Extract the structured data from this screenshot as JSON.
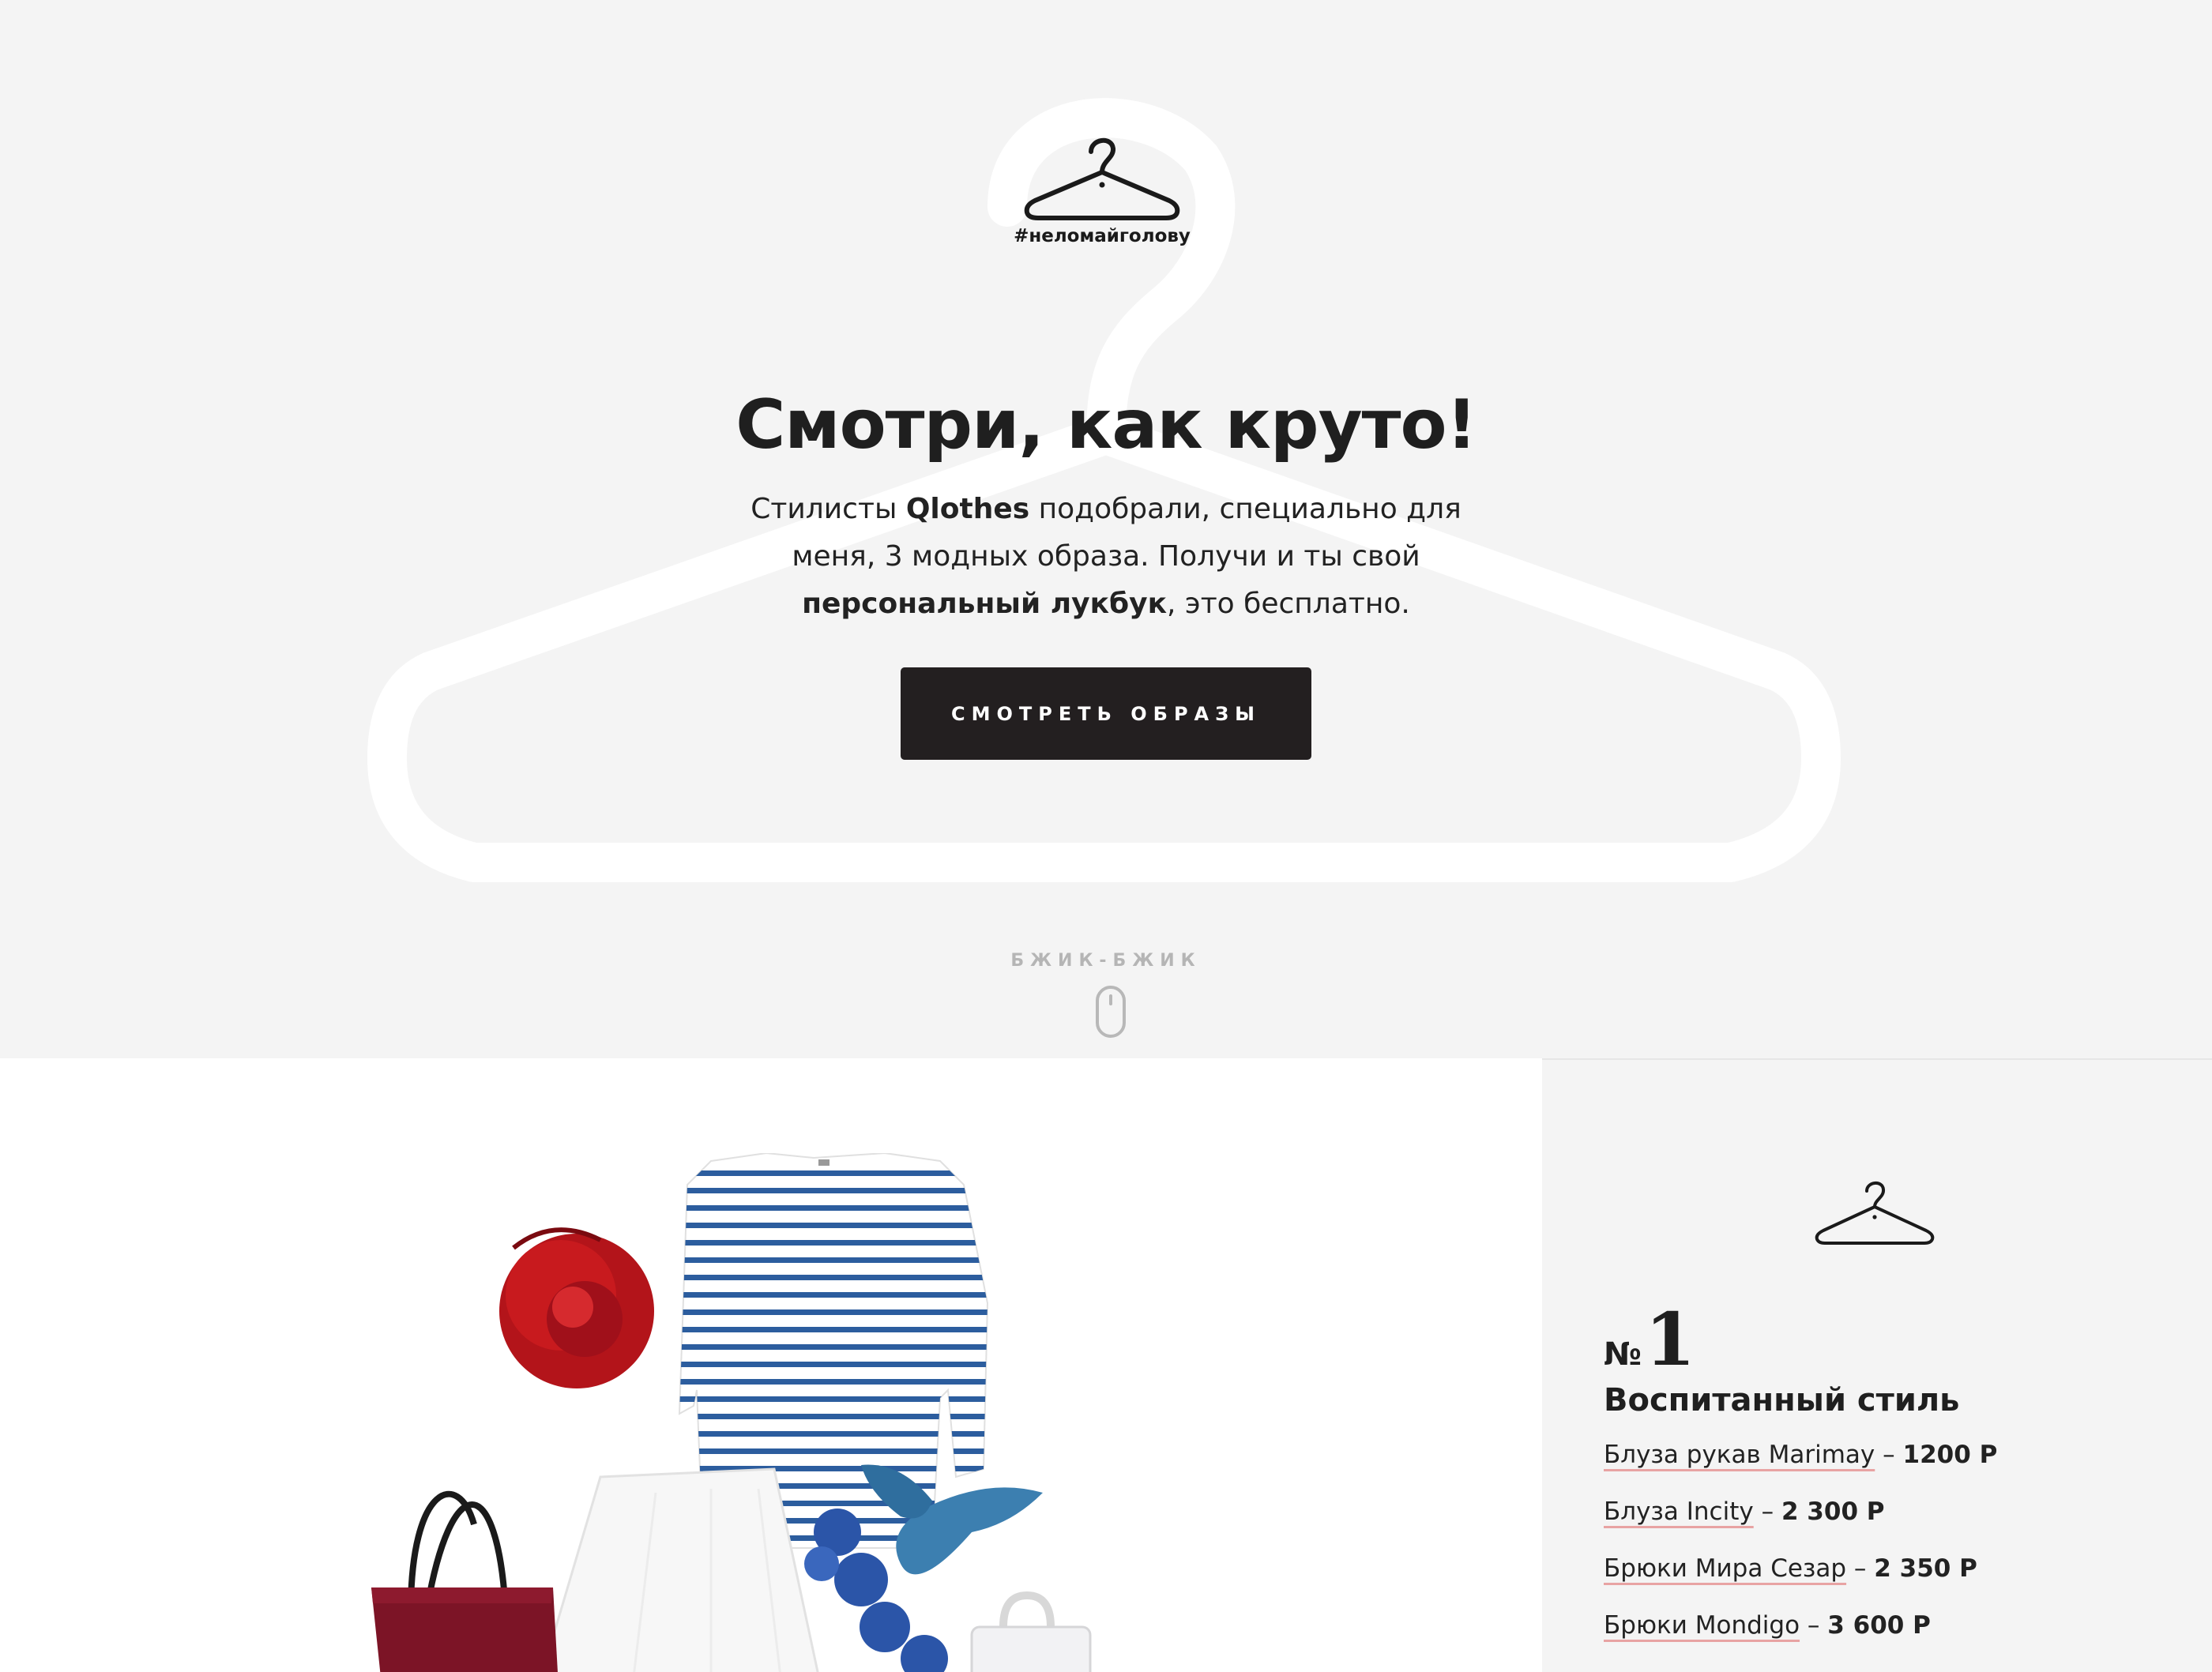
{
  "brand": {
    "hashtag": "#неломайголову"
  },
  "hero": {
    "title": "Смотри, как круто!",
    "text_part1": "Стилисты ",
    "brand_name": "Qlothes",
    "text_part2": " подобрали, специально для меня, 3 модных образа. Получи и ты свой ",
    "emphasis": "персональный лукбук",
    "text_part3": ", это бесплатно.",
    "cta_label": "СМОТРЕТЬ ОБРАЗЫ",
    "scroll_label": "БЖИК-БЖИК"
  },
  "look": {
    "number_symbol": "№",
    "number": "1",
    "title": "Воспитанный стиль",
    "items": [
      {
        "name": "Блуза рукав Marimay",
        "sep": " – ",
        "price": "1200 Р"
      },
      {
        "name": "Блуза Incity",
        "sep": " – ",
        "price": "2 300 Р"
      },
      {
        "name": "Брюки Мира Сезар",
        "sep": " – ",
        "price": "2 350 Р"
      },
      {
        "name": "Брюки Mondigo",
        "sep": " – ",
        "price": "3 600 Р"
      }
    ]
  },
  "icons": {
    "logo": "hanger-icon",
    "scroll": "mouse-icon",
    "look_hanger": "hanger-icon"
  },
  "colors": {
    "hero_bg": "#f4f4f4",
    "button_bg": "#231f20",
    "underline": "#e8a3a3",
    "stripe_blue": "#2c5d9e",
    "rose_red": "#c81a1e",
    "bag_red": "#7c1426"
  }
}
